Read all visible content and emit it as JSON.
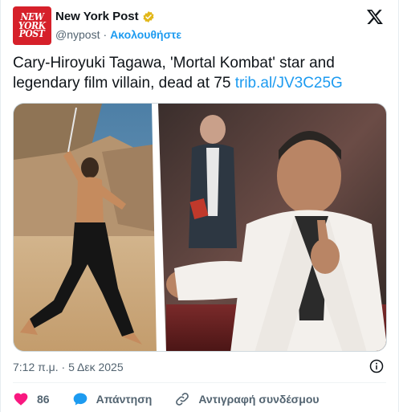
{
  "account": {
    "avatar_lines": [
      "NEW",
      "YORK",
      "POST"
    ],
    "name": "New York Post",
    "handle": "@nypost",
    "separator": "·",
    "follow_label": "Ακολουθήστε"
  },
  "tweet": {
    "text": "Cary-Hiroyuki Tagawa, 'Mortal Kombat' star and legendary film villain, dead at 75",
    "link": "trib.al/JV3C25G"
  },
  "meta": {
    "timestamp": "7:12 π.μ. · 5 Δεκ 2025"
  },
  "actions": {
    "like_count": "86",
    "reply_label": "Απάντηση",
    "copy_label": "Αντιγραφή συνδέσμου"
  },
  "colors": {
    "accent": "#1d9bf0",
    "like": "#f91880",
    "brand_red": "#d6202a",
    "verified_gold": "#e2b719"
  },
  "icons": {
    "verified": "verified-badge-icon",
    "x_logo": "x-logo-icon",
    "info": "info-icon",
    "heart": "heart-icon",
    "reply": "reply-bubble-icon",
    "link": "link-icon"
  }
}
